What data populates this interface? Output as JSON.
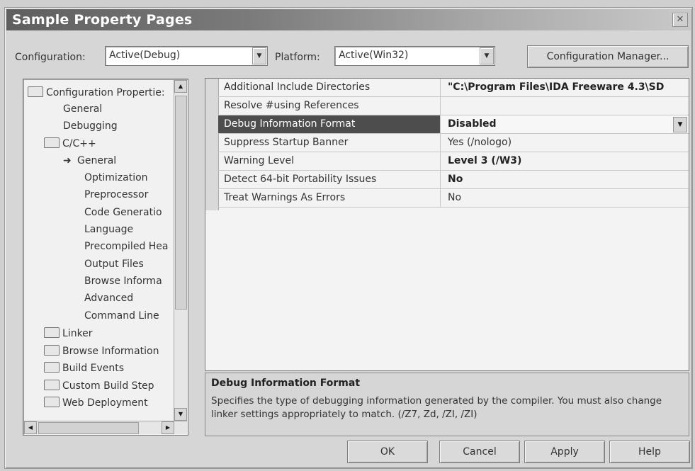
{
  "window": {
    "title": "Sample Property Pages"
  },
  "toolbar": {
    "configuration": {
      "label": "Configuration:",
      "value": "Active(Debug)"
    },
    "platform": {
      "label": "Platform:",
      "value": "Active(Win32)"
    },
    "config_manager_label": "Configuration Manager..."
  },
  "tree": {
    "items": [
      {
        "label": "Configuration Propertie:",
        "icon": "folder-open-icon"
      },
      {
        "label": "General"
      },
      {
        "label": "Debugging"
      },
      {
        "label": "C/C++",
        "icon": "folder-open-icon"
      },
      {
        "label": "General",
        "icon": "pointer-icon"
      },
      {
        "label": "Optimization"
      },
      {
        "label": "Preprocessor"
      },
      {
        "label": "Code Generatio"
      },
      {
        "label": "Language"
      },
      {
        "label": "Precompiled Hea"
      },
      {
        "label": "Output Files"
      },
      {
        "label": "Browse Informa"
      },
      {
        "label": "Advanced"
      },
      {
        "label": "Command Line"
      },
      {
        "label": "Linker",
        "icon": "folder-icon"
      },
      {
        "label": "Browse Information",
        "icon": "folder-icon"
      },
      {
        "label": "Build Events",
        "icon": "folder-icon"
      },
      {
        "label": "Custom Build Step",
        "icon": "folder-icon"
      },
      {
        "label": "Web Deployment",
        "icon": "folder-icon"
      }
    ]
  },
  "properties": [
    {
      "name": "Additional Include Directories",
      "value": "\"C:\\Program Files\\IDA Freeware 4.3\\SD"
    },
    {
      "name": "Resolve #using References",
      "value": ""
    },
    {
      "name": "Debug Information Format",
      "value": "Disabled"
    },
    {
      "name": "Suppress Startup Banner",
      "value": "Yes (/nologo)"
    },
    {
      "name": "Warning Level",
      "value": "Level 3 (/W3)"
    },
    {
      "name": "Detect 64-bit Portability Issues",
      "value": "No"
    },
    {
      "name": "Treat Warnings As Errors",
      "value": "No"
    }
  ],
  "description": {
    "title": "Debug Information Format",
    "text": "Specifies the type of debugging information generated by the compiler.  You must also change linker settings appropriately to match.   (/Z7, Zd, /ZI, /ZI)"
  },
  "buttons": {
    "ok": "OK",
    "cancel": "Cancel",
    "apply": "Apply",
    "help": "Help"
  }
}
